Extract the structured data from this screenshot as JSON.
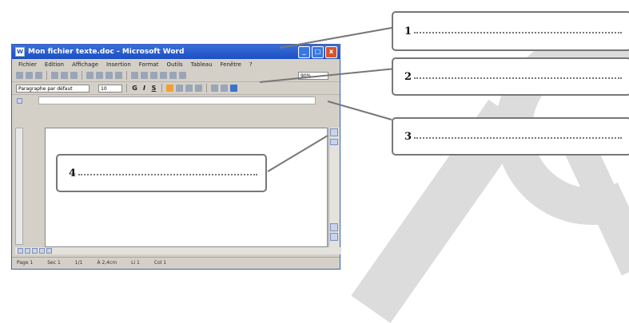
{
  "window": {
    "title": "Mon fichier texte.doc - Microsoft Word",
    "controls": {
      "minimize": "_",
      "maximize": "□",
      "close": "x"
    }
  },
  "menubar": [
    "Fichier",
    "Edition",
    "Affichage",
    "Insertion",
    "Format",
    "Outils",
    "Tableau",
    "Fenêtre",
    "?"
  ],
  "toolbar": {
    "zoom": "90%"
  },
  "formatting": {
    "style": "Paragraphe par défaut",
    "size": "10",
    "bold": "G",
    "italic": "I",
    "underline": "S"
  },
  "statusbar": [
    "Page 1",
    "Sec 1",
    "1/1",
    "À 2,4cm",
    "Li 1",
    "Col 1"
  ],
  "callouts": [
    {
      "number": "1"
    },
    {
      "number": "2"
    },
    {
      "number": "3"
    },
    {
      "number": "4"
    }
  ]
}
